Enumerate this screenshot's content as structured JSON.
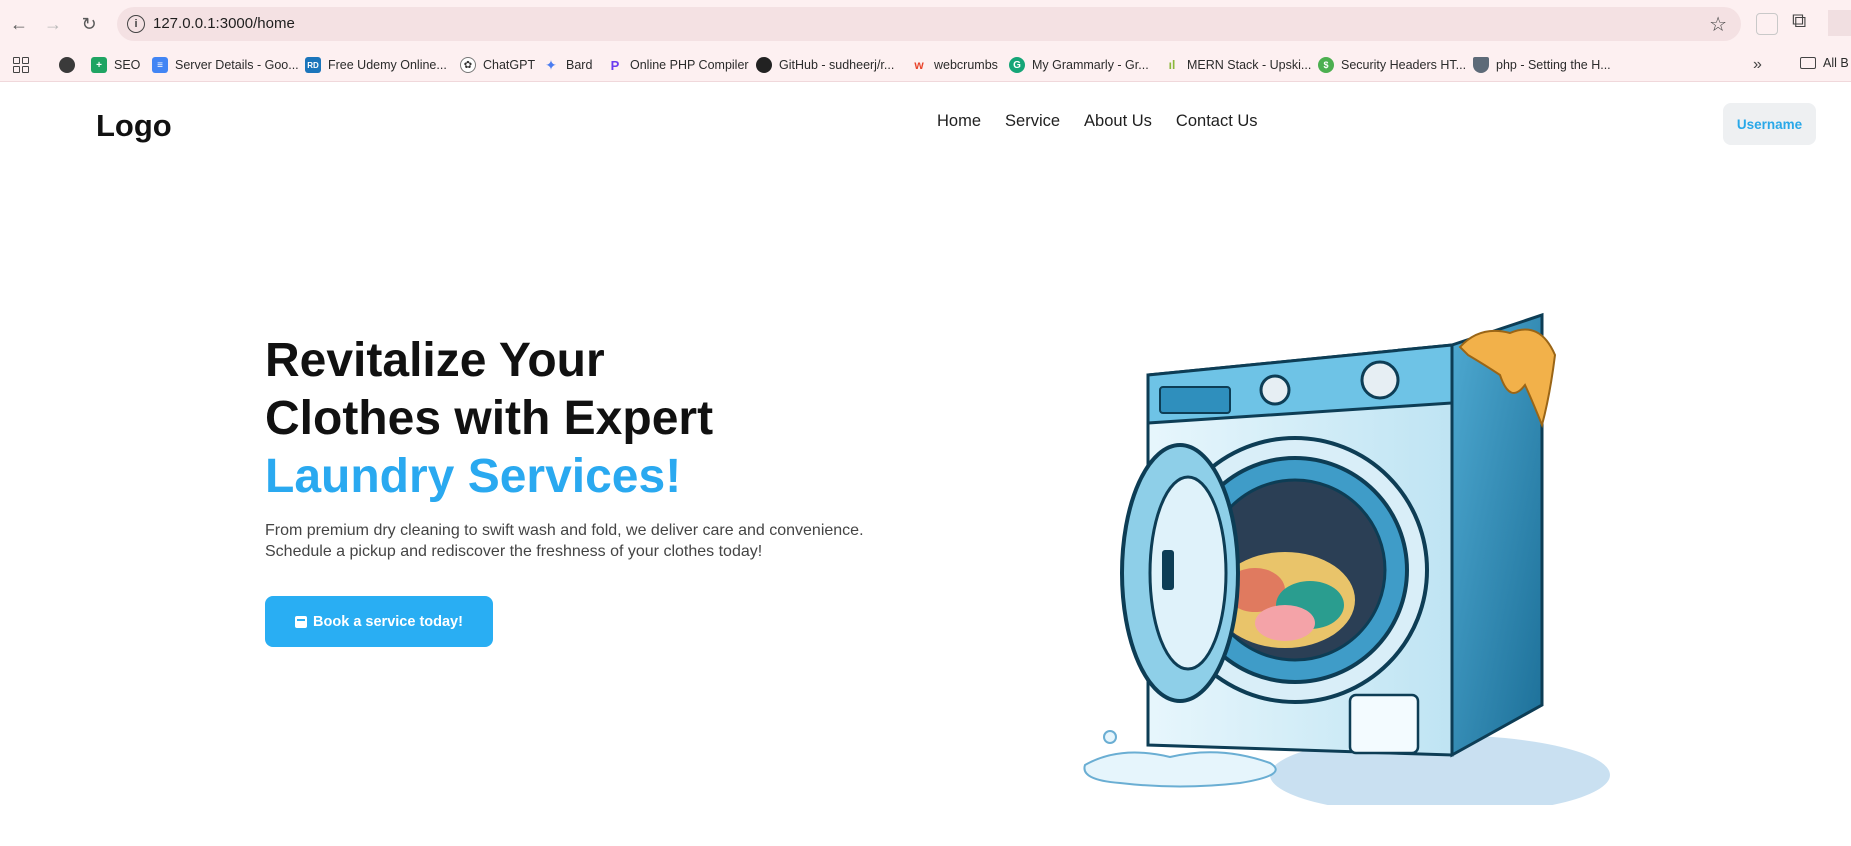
{
  "browser": {
    "url": "127.0.0.1:3000/home",
    "bookmarks": [
      {
        "label": "",
        "icon": "globe-icon"
      },
      {
        "label": "SEO",
        "icon": "sheets-icon"
      },
      {
        "label": "Server Details - Goo...",
        "icon": "docs-icon"
      },
      {
        "label": "Free Udemy Online...",
        "icon": "rd-icon"
      },
      {
        "label": "ChatGPT",
        "icon": "chatgpt-icon"
      },
      {
        "label": "Bard",
        "icon": "bard-icon"
      },
      {
        "label": "Online PHP Compiler",
        "icon": "php-compiler-icon"
      },
      {
        "label": "GitHub - sudheerj/r...",
        "icon": "github-icon"
      },
      {
        "label": "webcrumbs",
        "icon": "webcrumbs-icon"
      },
      {
        "label": "My Grammarly - Gr...",
        "icon": "grammarly-icon"
      },
      {
        "label": "MERN Stack - Upski...",
        "icon": "mern-icon"
      },
      {
        "label": "Security Headers HT...",
        "icon": "security-icon"
      },
      {
        "label": "php - Setting the H...",
        "icon": "shield-icon"
      }
    ],
    "all_bookmarks_label": "All B"
  },
  "header": {
    "logo": "Logo",
    "nav": [
      "Home",
      "Service",
      "About Us",
      "Contact Us"
    ],
    "user_button": "Username"
  },
  "hero": {
    "title_line1": "Revitalize Your",
    "title_line2": "Clothes with Expert",
    "title_accent": "Laundry Services!",
    "description": "From premium dry cleaning to swift wash and fold, we deliver care and convenience. Schedule a pickup and rediscover the freshness of your clothes today!",
    "cta_label": "Book a service today!"
  },
  "colors": {
    "accent": "#2aa9f0",
    "browser_bg": "#fdf0f1"
  }
}
